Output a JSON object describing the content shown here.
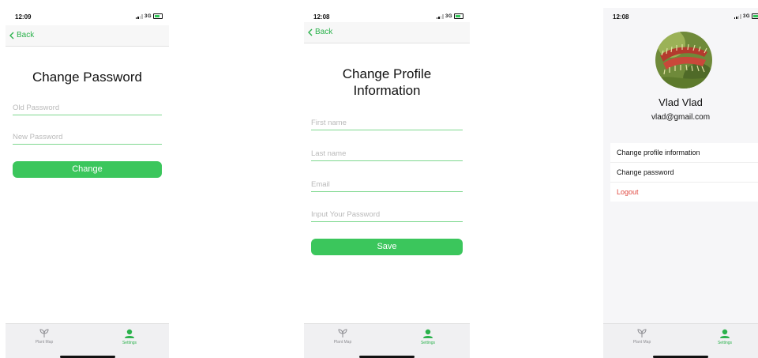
{
  "screens": {
    "change_password": {
      "status_time": "12:09",
      "network": "3G",
      "back_label": "Back",
      "title": "Change Password",
      "old_password_placeholder": "Old Password",
      "new_password_placeholder": "New Password",
      "button_label": "Change"
    },
    "change_profile": {
      "status_time": "12:08",
      "network": "3G",
      "back_label": "Back",
      "title_line1": "Change Profile",
      "title_line2": "Information",
      "first_name_placeholder": "First name",
      "last_name_placeholder": "Last name",
      "email_placeholder": "Email",
      "password_placeholder": "Input Your Password",
      "button_label": "Save"
    },
    "settings": {
      "status_time": "12:08",
      "network": "3G",
      "avatar_icon": "venus-flytrap-plant-photo",
      "name": "Vlad Vlad",
      "email": "vlad@gmail.com",
      "menu": [
        {
          "label": "Change profile information"
        },
        {
          "label": "Change password"
        },
        {
          "label": "Logout"
        }
      ]
    }
  },
  "tabbar": {
    "items": [
      {
        "label": "Plant Map",
        "icon": "plant-sprout-icon",
        "active": false
      },
      {
        "label": "Settings",
        "icon": "person-icon",
        "active": true
      }
    ]
  },
  "colors": {
    "accent": "#3bc65c",
    "accent_text": "#2bb24c",
    "underline": "#7fd88f",
    "logout": "#e0473f",
    "placeholder": "#b9b9b9"
  }
}
